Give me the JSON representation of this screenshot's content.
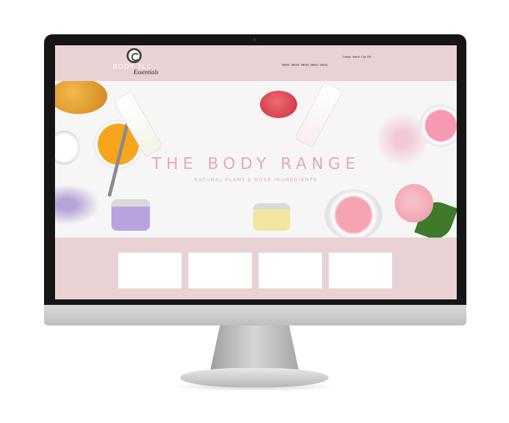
{
  "site": {
    "logo_text": "BODY TLC",
    "logo_script": "Essentials",
    "topbar": [
      "Contact",
      "Search",
      "Cart",
      "(0)"
    ],
    "nav": [
      "MENU",
      "MENU",
      "MENU",
      "MENU",
      "MENU"
    ]
  },
  "hero": {
    "title": "THE BODY RANGE",
    "subtitle": "NATURAL PLANT & ROSE INGREDIENTS"
  },
  "cards": [
    {
      "label": ""
    },
    {
      "label": ""
    },
    {
      "label": ""
    },
    {
      "label": ""
    }
  ],
  "colors": {
    "site_background": "#e8d2d4",
    "hero_title": "#e5a8b6",
    "monitor_bezel": "#151515"
  }
}
